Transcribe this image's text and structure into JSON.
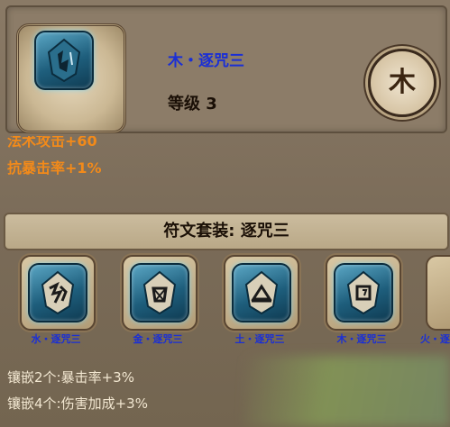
{
  "rune": {
    "title": "木・逐咒三",
    "level": "等级 3",
    "element_glyph": "木",
    "icon": "rune-glyph-icon"
  },
  "stats": [
    {
      "text": "法术攻击+60"
    },
    {
      "text": "抗暴击率+1%"
    }
  ],
  "set": {
    "title": "符文套装: 逐咒三"
  },
  "set_runes": [
    {
      "name": "水・逐咒三",
      "icon": "rune-water-icon"
    },
    {
      "name": "金・逐咒三",
      "icon": "rune-metal-icon"
    },
    {
      "name": "土・逐咒三",
      "icon": "rune-earth-icon"
    },
    {
      "name": "木・逐咒三",
      "icon": "rune-wood-icon"
    },
    {
      "name": "火・逐咒三",
      "icon": "rune-fire-icon"
    }
  ],
  "set_bonuses": [
    {
      "text": "镶嵌2个:暴击率+3%"
    },
    {
      "text": "镶嵌4个:伤害加成+3%"
    }
  ],
  "colors": {
    "rune_name": "#1a2fd6",
    "stat": "#f28a1a",
    "bonus": "#f1e6d0"
  }
}
